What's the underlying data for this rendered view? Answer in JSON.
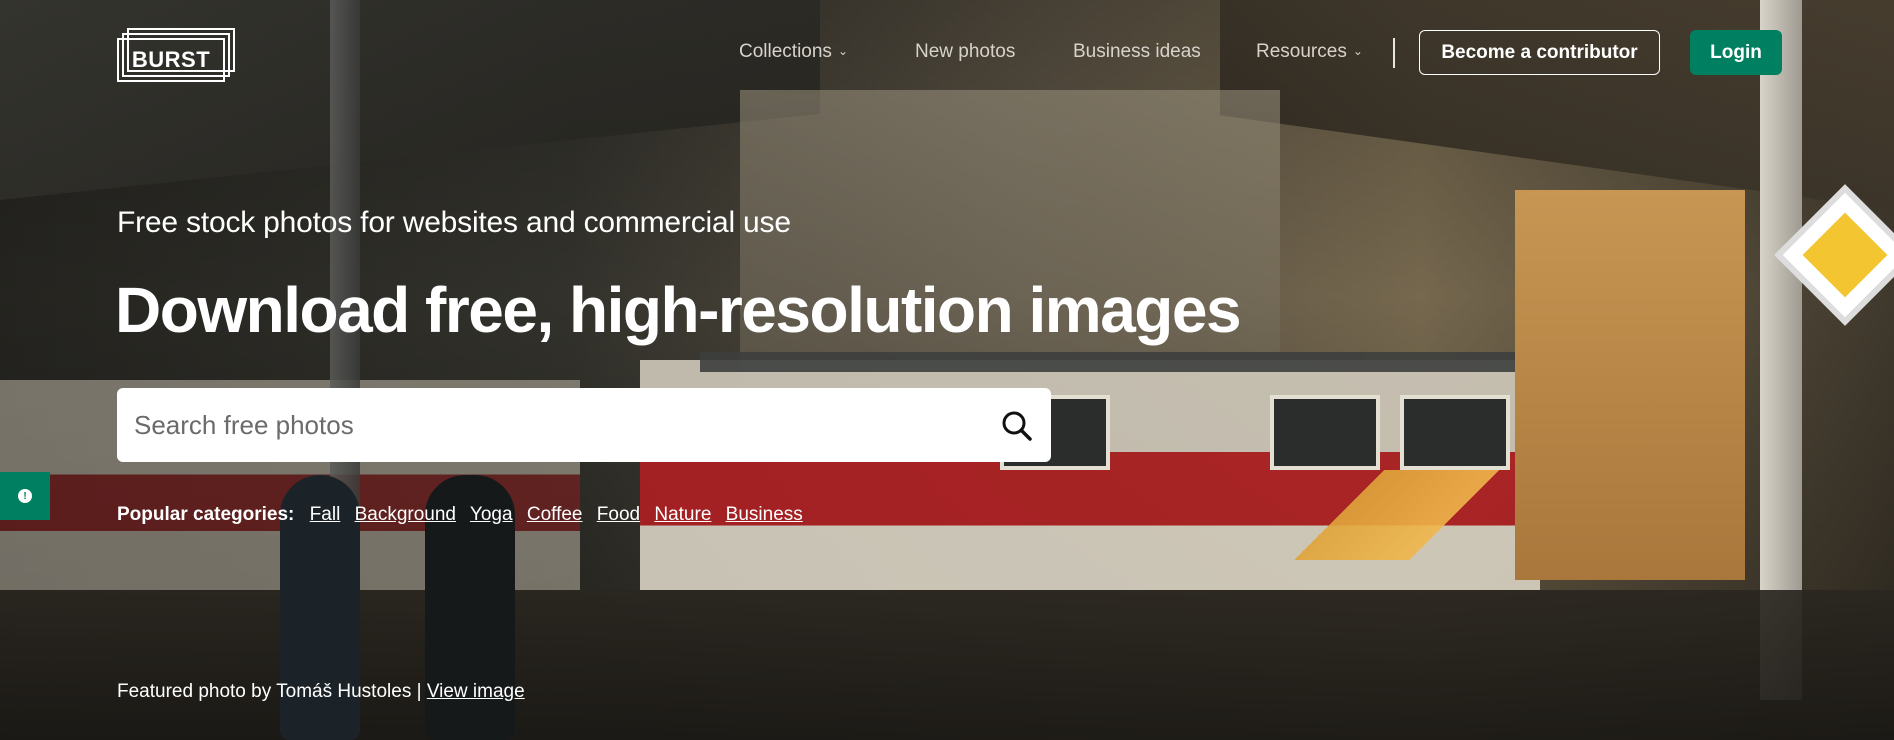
{
  "logo": {
    "text": "BURST"
  },
  "nav": {
    "collections": "Collections",
    "new_photos": "New photos",
    "business_ideas": "Business ideas",
    "resources": "Resources",
    "become_contributor": "Become a contributor",
    "login": "Login"
  },
  "hero": {
    "subtitle": "Free stock photos for websites and commercial use",
    "title": "Download free, high-resolution images"
  },
  "search": {
    "placeholder": "Search free photos"
  },
  "popular": {
    "label": "Popular categories:",
    "categories": [
      "Fall",
      "Background",
      "Yoga",
      "Coffee",
      "Food",
      "Nature",
      "Business"
    ]
  },
  "credit": {
    "text": "Featured photo by Tomáš Hustoles |",
    "link": "View image"
  },
  "colors": {
    "accent": "#008060"
  },
  "icons": {
    "search": "search-icon",
    "chevron": "chevron-down-icon",
    "feedback": "feedback-icon"
  }
}
